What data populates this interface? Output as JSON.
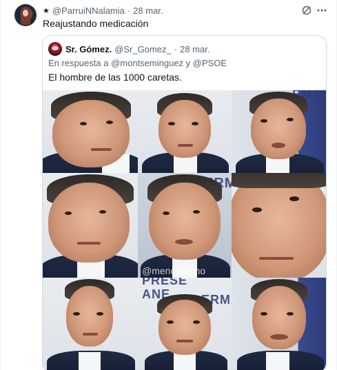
{
  "tweet": {
    "author_handle": "@ParruiNNalamia",
    "date": "28 mar.",
    "text": "Reajustando medicación"
  },
  "quote": {
    "display_name": "Sr. Gómez.",
    "handle": "@Sr_Gomez_",
    "date": "28 mar.",
    "reply_prefix": "En respuesta a",
    "reply_mentions": "@montseminguez y @PSOE",
    "text": "El hombre de las 1000 caretas."
  },
  "image": {
    "bg_words": [
      "EMA",
      "PRESE",
      "ANE",
      "ERMA",
      "ERMA"
    ],
    "watermark": "@mencabrono"
  },
  "icons": {
    "grok": "grok-icon",
    "more": "more-dots-icon"
  },
  "colors": {
    "text_primary": "#0f1419",
    "text_secondary": "#536471",
    "border": "#cfd9de"
  }
}
